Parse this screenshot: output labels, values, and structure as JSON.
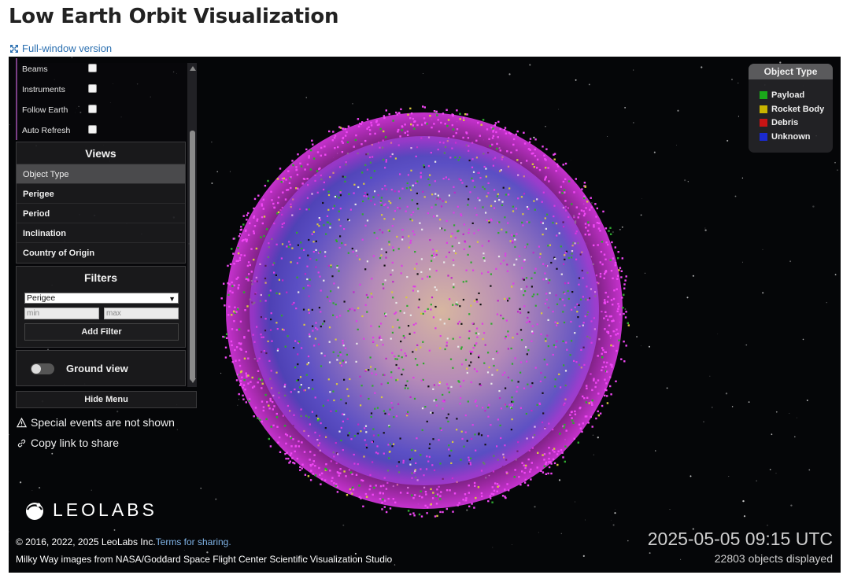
{
  "page": {
    "title": "Low Earth Orbit Visualization",
    "full_window_link": "Full-window version"
  },
  "menu": {
    "options": [
      {
        "label": "Beams"
      },
      {
        "label": "Instruments"
      },
      {
        "label": "Follow Earth"
      },
      {
        "label": "Auto Refresh"
      }
    ],
    "views": {
      "title": "Views",
      "items": [
        "Object Type",
        "Perigee",
        "Period",
        "Inclination",
        "Country of Origin"
      ],
      "active": "Object Type"
    },
    "filters": {
      "title": "Filters",
      "selected": "Perigee",
      "min_placeholder": "min",
      "max_placeholder": "max",
      "add_label": "Add Filter"
    },
    "ground_view_label": "Ground view",
    "hide_menu_label": "Hide Menu"
  },
  "notes": {
    "special_events": "Special events are not shown",
    "copy_link": "Copy link to share"
  },
  "legend": {
    "title": "Object Type",
    "items": [
      {
        "label": "Payload",
        "color": "#1aa81a"
      },
      {
        "label": "Rocket Body",
        "color": "#c8b400"
      },
      {
        "label": "Debris",
        "color": "#c81414"
      },
      {
        "label": "Unknown",
        "color": "#1a2ad0"
      }
    ]
  },
  "branding": {
    "logo_text": "LEOLABS",
    "copyright": "© 2016, 2022, 2025 LeoLabs Inc.",
    "terms_link": "Terms for sharing.",
    "milky_way_credit": "Milky Way images from NASA/Goddard Space Flight Center Scientific Visualization Studio"
  },
  "status": {
    "datetime": "2025-05-05 09:15 UTC",
    "objects_displayed": "22803 objects displayed"
  },
  "colors": {
    "accent_link": "#2a6fb0",
    "orbit_magenta": "#d030d8",
    "earth_blue": "#5a4ad0"
  }
}
